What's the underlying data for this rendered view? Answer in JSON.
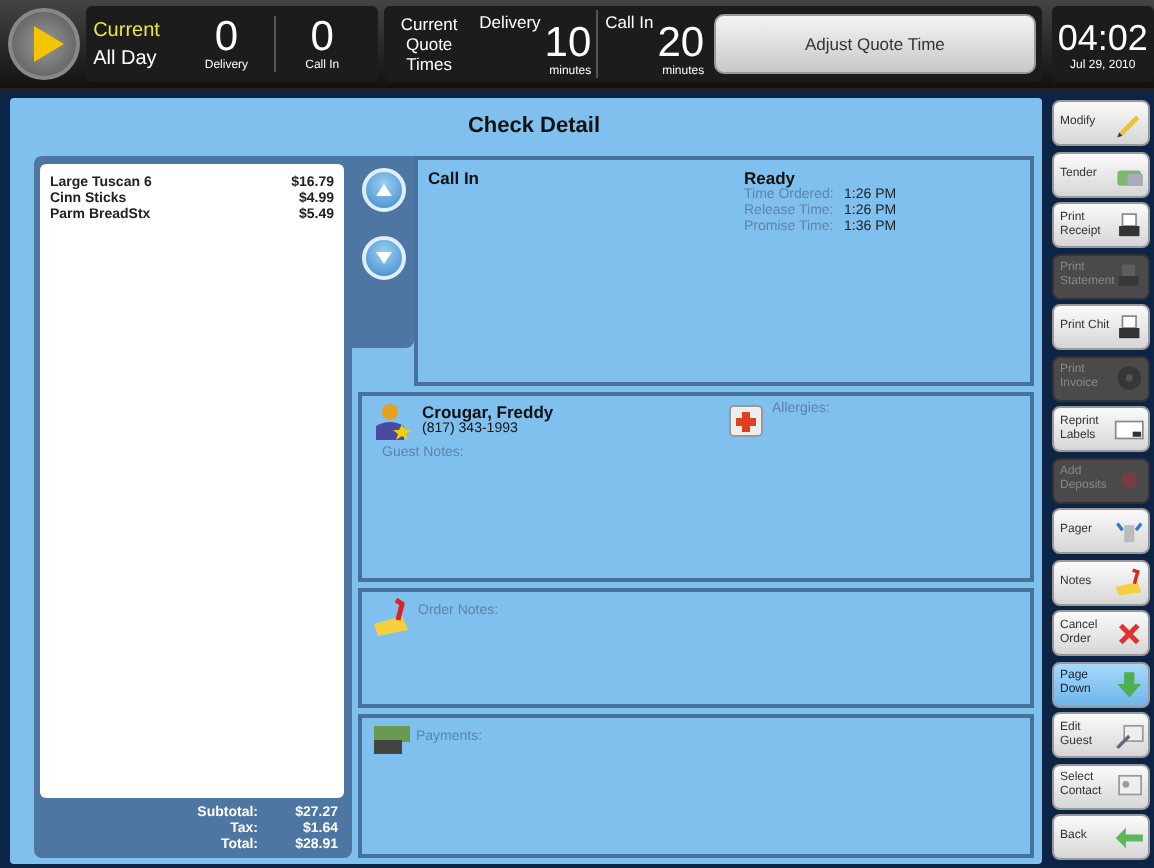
{
  "header": {
    "period": {
      "label": "Current",
      "value": "All Day"
    },
    "counts": [
      {
        "number": "0",
        "label": "Delivery"
      },
      {
        "number": "0",
        "label": "Call In"
      }
    ],
    "quote_label": "Current Quote Times",
    "quotes": [
      {
        "label": "Delivery",
        "number": "10",
        "unit": "minutes"
      },
      {
        "label": "Call In",
        "number": "20",
        "unit": "minutes"
      }
    ],
    "adjust_button": "Adjust Quote Time",
    "clock": {
      "time": "04:02",
      "date": "Jul 29, 2010"
    }
  },
  "check": {
    "title": "Check Detail",
    "items": [
      {
        "name": "Large Tuscan 6",
        "price": "$16.79"
      },
      {
        "name": "Cinn Sticks",
        "price": "$4.99"
      },
      {
        "name": "Parm BreadStx",
        "price": "$5.49"
      }
    ],
    "totals": [
      {
        "label": "Subtotal:",
        "value": "$27.27"
      },
      {
        "label": "Tax:",
        "value": "$1.64"
      },
      {
        "label": "Total:",
        "value": "$28.91"
      }
    ],
    "order_type": "Call In",
    "status": "Ready",
    "times": [
      {
        "label": "Time Ordered:",
        "value": "1:26 PM"
      },
      {
        "label": "Release Time:",
        "value": "1:26 PM"
      },
      {
        "label": "Promise Time:",
        "value": "1:36 PM"
      }
    ],
    "customer": {
      "name": "Crougar, Freddy",
      "phone": "(817) 343-1993",
      "guest_notes_label": "Guest Notes:",
      "allergies_label": "Allergies:"
    },
    "order_notes_label": "Order Notes:",
    "payments_label": "Payments:"
  },
  "actions": [
    {
      "label": "Modify",
      "disabled": false,
      "selected": false
    },
    {
      "label": "Tender",
      "disabled": false,
      "selected": false
    },
    {
      "label": "Print Receipt",
      "disabled": false,
      "selected": false
    },
    {
      "label": "Print Statement",
      "disabled": true,
      "selected": false
    },
    {
      "label": "Print Chit",
      "disabled": false,
      "selected": false
    },
    {
      "label": "Print Invoice",
      "disabled": true,
      "selected": false
    },
    {
      "label": "Reprint Labels",
      "disabled": false,
      "selected": false
    },
    {
      "label": "Add Deposits",
      "disabled": true,
      "selected": false
    },
    {
      "label": "Pager",
      "disabled": false,
      "selected": false
    },
    {
      "label": "Notes",
      "disabled": false,
      "selected": false
    },
    {
      "label": "Cancel Order",
      "disabled": false,
      "selected": false
    },
    {
      "label": "Page Down",
      "disabled": false,
      "selected": true
    },
    {
      "label": "Edit Guest",
      "disabled": false,
      "selected": false
    },
    {
      "label": "Select Contact",
      "disabled": false,
      "selected": false
    },
    {
      "label": "Back",
      "disabled": false,
      "selected": false
    }
  ]
}
